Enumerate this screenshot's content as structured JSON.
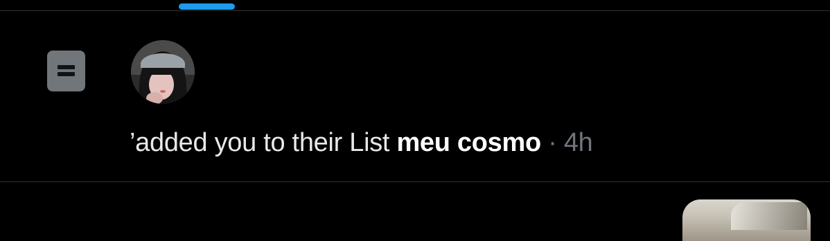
{
  "tabs": {
    "active_indicator_color": "#1d9bf0"
  },
  "notification": {
    "type_icon": "list-icon",
    "avatar_icon": "user-avatar",
    "truncated_prefix": "’",
    "action_text": "added you to their List",
    "list_name": "meu cosmo",
    "separator": "·",
    "timestamp": "4h"
  },
  "next_item": {
    "media_icon": "media-thumbnail"
  },
  "colors": {
    "background": "#000000",
    "text_primary": "#e7e9ea",
    "text_secondary": "#71767b",
    "divider": "#2f3336"
  }
}
